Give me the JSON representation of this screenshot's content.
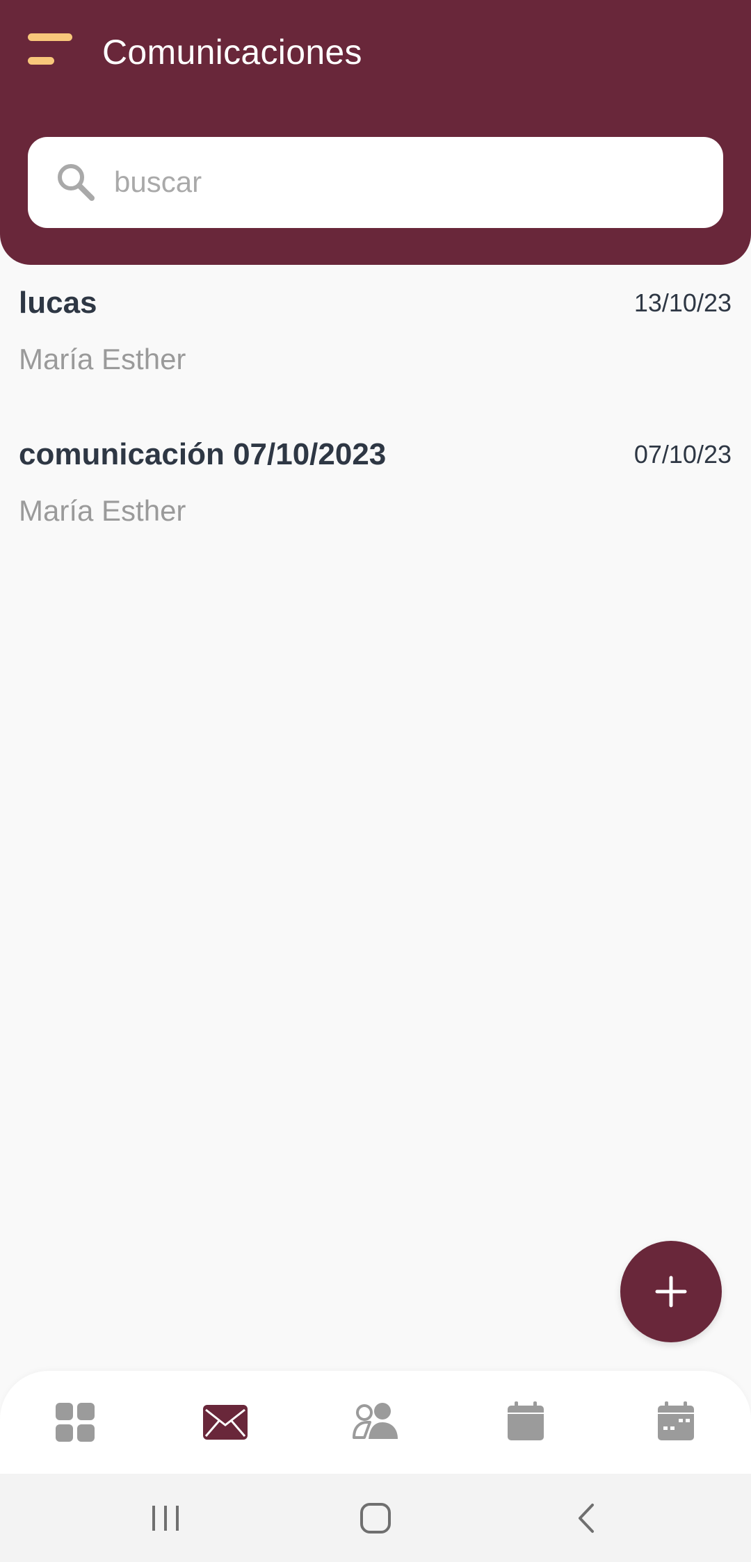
{
  "header": {
    "title": "Comunicaciones",
    "menu_icon": "menu-icon"
  },
  "search": {
    "placeholder": "buscar",
    "value": "",
    "icon": "search-icon"
  },
  "communications": [
    {
      "title": "lucas",
      "date": "13/10/23",
      "author": "María Esther"
    },
    {
      "title": "comunicación 07/10/2023",
      "date": "07/10/23",
      "author": "María Esther"
    }
  ],
  "fab": {
    "icon": "plus-icon"
  },
  "bottom_nav": {
    "items": [
      {
        "icon": "dashboard-grid-icon",
        "active": false
      },
      {
        "icon": "mail-icon",
        "active": true
      },
      {
        "icon": "people-icon",
        "active": false
      },
      {
        "icon": "calendar-icon",
        "active": false
      },
      {
        "icon": "calendar-events-icon",
        "active": false
      }
    ]
  },
  "system_nav": {
    "items": [
      "recents-icon",
      "home-icon",
      "back-icon"
    ]
  },
  "colors": {
    "brand": "#69273a",
    "accent": "#f8c77b",
    "background": "#f9f9f9",
    "text_primary": "#2e3744",
    "text_secondary": "#9a9a9a",
    "inactive_icon": "#9b9b9b"
  }
}
